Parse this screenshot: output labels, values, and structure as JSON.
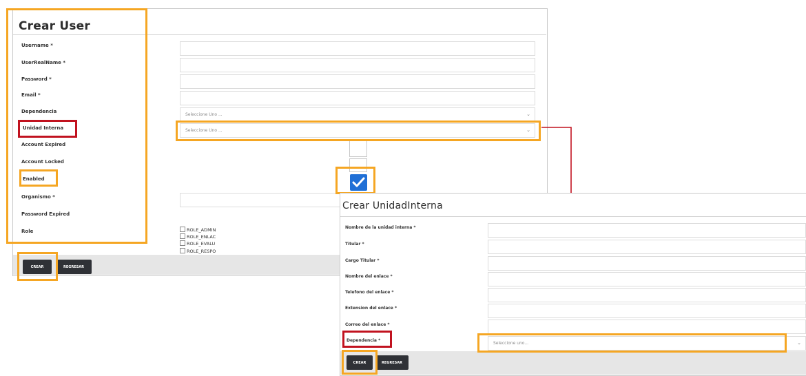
{
  "user_form": {
    "title": "Crear User",
    "labels": [
      "Username *",
      "UserRealName *",
      "Password *",
      "Email *",
      "Dependencia",
      "Unidad Interna",
      "Account Expired",
      "Account Locked",
      "Enabled",
      "Organismo *",
      "Password Expired",
      "Role"
    ],
    "dependencia_select": "Seleccione Uno ...",
    "unidad_select": "Seleccione Uno ...",
    "roles": [
      "ROLE_ADMIN",
      "ROLE_ENLAC",
      "ROLE_EVALU",
      "ROLE_RESPO"
    ],
    "create_button": "CREAR",
    "back_button": "REGRESAR"
  },
  "unidad_form": {
    "title": "Crear UnidadInterna",
    "labels": [
      "Nombre de la unidad interna *",
      "Titular *",
      "Cargo Titular *",
      "Nombre del enlace *",
      "Telefono del enlace *",
      "Extension del enlace *",
      "Correo del enlace *",
      "Dependencia *"
    ],
    "dependencia_select": "Seleccione uno...",
    "create_button": "CREAR",
    "back_button": "REGRESAR"
  },
  "colors": {
    "highlight_orange": "#f5a623",
    "highlight_red": "#c1121f",
    "checkbox_blue": "#1f6fd6"
  }
}
